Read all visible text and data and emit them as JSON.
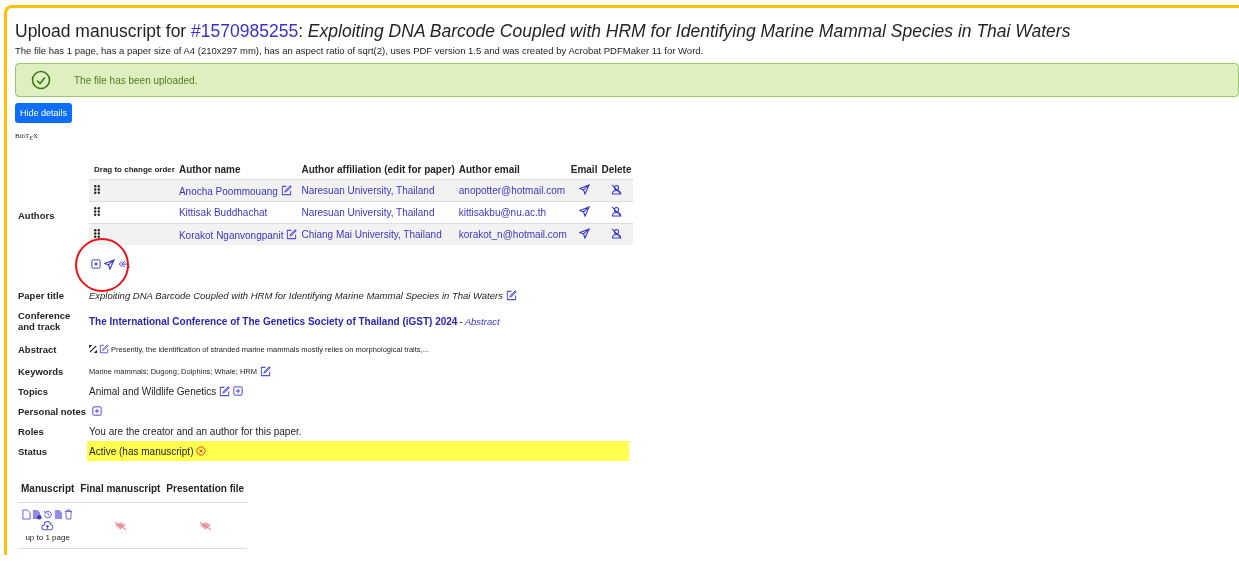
{
  "title": {
    "prefix": "Upload manuscript for ",
    "paper_id": "#1570985255",
    "separator": ": ",
    "paper_title": "Exploiting DNA Barcode Coupled with HRM for Identifying Marine Mammal Species in Thai Waters"
  },
  "file_info": "The file has 1 page, has a paper size of A4 (210x297 mm), has an aspect ratio of sqrt(2), uses PDF version 1.5 and was created by Acrobat PDFMaker 11 for Word.",
  "alert": "The file has been uploaded.",
  "hide_button": "Hide details",
  "bibtex": "BibT$_{E}$X",
  "authors": {
    "label": "Authors",
    "columns": [
      "Drag to change order",
      "Author name",
      "Author affiliation (edit for paper)",
      "Author email",
      "Email",
      "Delete"
    ],
    "rows": [
      {
        "name": "Anocha Poommouang",
        "editable": true,
        "affiliation": "Naresuan University, Thailand",
        "email": "anopotter@hotmail.com"
      },
      {
        "name": "Kittisak Buddhachat",
        "editable": false,
        "affiliation": "Naresuan University, Thailand",
        "email": "kittisakbu@nu.ac.th"
      },
      {
        "name": "Korakot Nganvongpanit",
        "editable": true,
        "affiliation": "Chiang Mai University, Thailand",
        "email": "korakot_n@hotmail.com"
      }
    ]
  },
  "details": [
    {
      "label": "Paper title",
      "kind": "italic",
      "text": "Exploiting DNA Barcode Coupled with HRM for Identifying Marine Mammal Species in Thai Waters",
      "edit": true,
      "add": false
    },
    {
      "label": "Conference and track",
      "kind": "conference",
      "text": "The International Conference of The Genetics Society of Thailand (iGST) 2024",
      "separator": " - ",
      "track": "Abstract",
      "edit": false,
      "add": false
    },
    {
      "label": "Abstract",
      "kind": "abstract",
      "text": "Presently, the identification of stranded marine mammals mostly relies on morphological traits,...",
      "edit": true,
      "add": false
    },
    {
      "label": "Keywords",
      "kind": "small",
      "text": "Marine mammals; Dugong; Dolphins; Whale; HRM",
      "edit": true,
      "add": false
    },
    {
      "label": "Topics",
      "kind": "plain",
      "text": "Animal and Wildlife Genetics",
      "edit": true,
      "add": true
    },
    {
      "label": "Personal notes",
      "kind": "plain",
      "edit": false,
      "add": true
    },
    {
      "label": "Roles",
      "kind": "plain",
      "text": "You are the creator and an author for this paper.",
      "edit": false,
      "add": false
    },
    {
      "label": "Status",
      "kind": "status",
      "text": "Active (has manuscript)",
      "edit": false,
      "add": false
    }
  ],
  "files": [
    {
      "header": "Manuscript",
      "kind": "uploaded",
      "note": "up to 1 page"
    },
    {
      "header": "Final manuscript",
      "kind": "unavailable"
    },
    {
      "header": "Presentation file",
      "kind": "unavailable"
    }
  ]
}
